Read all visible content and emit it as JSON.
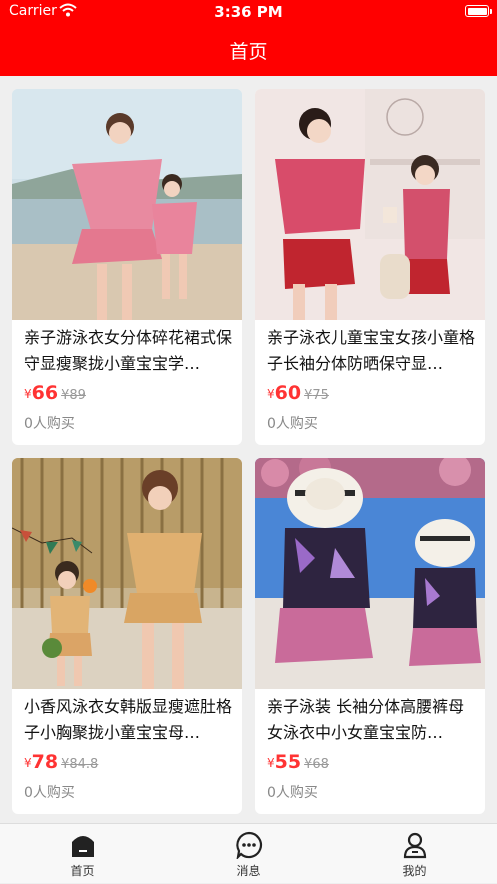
{
  "status": {
    "carrier": "Carrier",
    "time": "3:36 PM"
  },
  "nav": {
    "title": "首页"
  },
  "currency": "¥",
  "products": [
    {
      "title": "亲子游泳衣女分体碎花裙式保守显瘦聚拢小童宝宝学…",
      "price": "66",
      "old_price": "89",
      "sold": "0人购买"
    },
    {
      "title": "亲子泳衣儿童宝宝女孩小童格子长袖分体防晒保守显…",
      "price": "60",
      "old_price": "75",
      "sold": "0人购买"
    },
    {
      "title": "小香风泳衣女韩版显瘦遮肚格子小胸聚拢小童宝宝母…",
      "price": "78",
      "old_price": "84.8",
      "sold": "0人购买"
    },
    {
      "title": "亲子泳装 长袖分体高腰裤母女泳衣中小女童宝宝防…",
      "price": "55",
      "old_price": "68",
      "sold": "0人购买"
    }
  ],
  "tabs": [
    {
      "label": "首页",
      "icon": "home-icon"
    },
    {
      "label": "消息",
      "icon": "message-icon"
    },
    {
      "label": "我的",
      "icon": "profile-icon"
    }
  ],
  "colors": {
    "brand": "#ff0000",
    "price": "#ff3333",
    "background": "#efefef"
  }
}
